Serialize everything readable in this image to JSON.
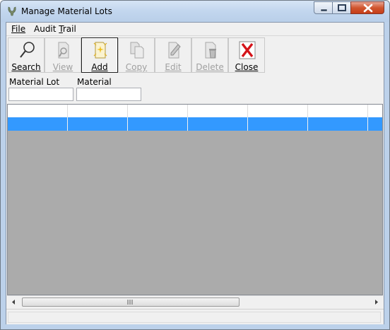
{
  "window": {
    "title": "Manage Material Lots",
    "controls": {
      "minimize_icon": "minimize-icon",
      "maximize_icon": "maximize-icon",
      "close_icon": "close-icon"
    }
  },
  "menu": {
    "items": [
      {
        "label": "File",
        "accel": "F"
      },
      {
        "label": "Audit Trail",
        "accel": "T"
      }
    ]
  },
  "toolbar": {
    "buttons": [
      {
        "id": "search",
        "label": "Search",
        "icon": "search-icon",
        "enabled": true
      },
      {
        "id": "view",
        "label": "View",
        "icon": "view-icon",
        "enabled": false
      },
      {
        "id": "add",
        "label": "Add",
        "icon": "add-icon",
        "enabled": true,
        "focused": true
      },
      {
        "id": "copy",
        "label": "Copy",
        "icon": "copy-icon",
        "enabled": false
      },
      {
        "id": "edit",
        "label": "Edit",
        "icon": "edit-icon",
        "enabled": false
      },
      {
        "id": "delete",
        "label": "Delete",
        "icon": "delete-icon",
        "enabled": false
      },
      {
        "id": "close",
        "label": "Close",
        "icon": "close-x-icon",
        "enabled": true
      }
    ]
  },
  "filters": {
    "material_lot": {
      "label": "Material Lot",
      "value": ""
    },
    "material": {
      "label": "Material",
      "value": ""
    }
  },
  "grid": {
    "columns": [
      "",
      "",
      "",
      "",
      "",
      "",
      ""
    ],
    "rows": [
      {
        "selected": true,
        "cells": [
          "",
          "",
          "",
          "",
          "",
          "",
          ""
        ]
      }
    ],
    "selection_color": "#3399ff",
    "background_color": "#ababab"
  },
  "scrollbar": {
    "left_icon": "scroll-left-icon",
    "right_icon": "scroll-right-icon",
    "grip_icon": "scroll-grip-icon"
  },
  "status": {
    "text": ""
  }
}
